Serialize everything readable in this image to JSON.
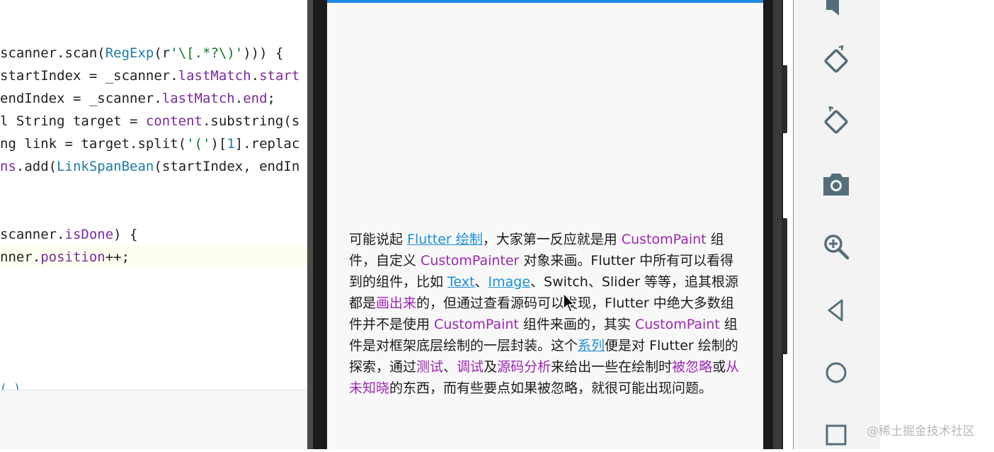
{
  "editor": {
    "lines": [
      [
        {
          "t": "scanner.scan(",
          "c": "c-plain"
        },
        {
          "t": "RegExp",
          "c": "c-cls"
        },
        {
          "t": "(r",
          "c": "c-plain"
        },
        {
          "t": "'\\[.*?\\)'",
          "c": "c-str"
        },
        {
          "t": "))) {",
          "c": "c-plain"
        }
      ],
      [
        {
          "t": "startIndex = _scanner.",
          "c": "c-plain"
        },
        {
          "t": "lastMatch",
          "c": "c-fld"
        },
        {
          "t": ".",
          "c": "c-plain"
        },
        {
          "t": "start",
          "c": "c-fld"
        }
      ],
      [
        {
          "t": "endIndex = _scanner.",
          "c": "c-plain"
        },
        {
          "t": "lastMatch",
          "c": "c-fld"
        },
        {
          "t": ".",
          "c": "c-plain"
        },
        {
          "t": "end",
          "c": "c-fld"
        },
        {
          "t": ";",
          "c": "c-plain"
        }
      ],
      [
        {
          "t": "l String target = ",
          "c": "c-plain"
        },
        {
          "t": "content",
          "c": "c-fld"
        },
        {
          "t": ".substring(s",
          "c": "c-plain"
        }
      ],
      [
        {
          "t": "ng link = target.split(",
          "c": "c-plain"
        },
        {
          "t": "'('",
          "c": "c-str"
        },
        {
          "t": ")[",
          "c": "c-plain"
        },
        {
          "t": "1",
          "c": "c-cls"
        },
        {
          "t": "].replac",
          "c": "c-plain"
        }
      ],
      [
        {
          "t": "ns",
          "c": "c-fld"
        },
        {
          "t": ".add(",
          "c": "c-plain"
        },
        {
          "t": "LinkSpanBean",
          "c": "c-cls"
        },
        {
          "t": "(startIndex, endIn",
          "c": "c-plain"
        }
      ],
      [
        {
          "t": "",
          "c": "c-plain"
        }
      ],
      [
        {
          "t": "",
          "c": "c-plain"
        }
      ],
      [
        {
          "t": "scanner.",
          "c": "c-plain"
        },
        {
          "t": "isDone",
          "c": "c-fld"
        },
        {
          "t": ") {",
          "c": "c-plain"
        }
      ],
      [
        {
          "t": "nner.",
          "c": "c-plain"
        },
        {
          "t": "position",
          "c": "c-fld"
        },
        {
          "t": "++;",
          "c": "c-plain"
        }
      ]
    ]
  },
  "article": {
    "segments": [
      {
        "t": "可能说起 ",
        "c": ""
      },
      {
        "t": "Flutter 绘制",
        "c": "link"
      },
      {
        "t": "，大家第一反应就是用 ",
        "c": ""
      },
      {
        "t": "CustomPaint",
        "c": "purple"
      },
      {
        "t": " 组件，自定义 ",
        "c": ""
      },
      {
        "t": "CustomPainter",
        "c": "purple"
      },
      {
        "t": " 对象来画。Flutter 中所有可以看得到的组件，比如 ",
        "c": ""
      },
      {
        "t": "Text",
        "c": "link"
      },
      {
        "t": "、",
        "c": ""
      },
      {
        "t": "Image",
        "c": "link"
      },
      {
        "t": "、Switch、Slider 等等，追其根源都是",
        "c": ""
      },
      {
        "t": "画出来",
        "c": "purple"
      },
      {
        "t": "的，但通过查看源码可以发现，Flutter 中绝大多数组件并不是使用 ",
        "c": ""
      },
      {
        "t": "CustomPaint",
        "c": "purple"
      },
      {
        "t": " 组件来画的，其实 ",
        "c": ""
      },
      {
        "t": "CustomPaint",
        "c": "purple"
      },
      {
        "t": " 组件是对框架底层绘制的一层封装。这个",
        "c": ""
      },
      {
        "t": "系列",
        "c": "link"
      },
      {
        "t": "便是对 Flutter 绘制的探索，通过",
        "c": ""
      },
      {
        "t": "测试",
        "c": "purple"
      },
      {
        "t": "、",
        "c": ""
      },
      {
        "t": "调试",
        "c": "purple"
      },
      {
        "t": "及",
        "c": ""
      },
      {
        "t": "源码分析",
        "c": "purple"
      },
      {
        "t": "来给出一些在绘制时",
        "c": ""
      },
      {
        "t": "被忽略",
        "c": "purple"
      },
      {
        "t": "或",
        "c": ""
      },
      {
        "t": "从未知晓",
        "c": "purple"
      },
      {
        "t": "的东西，而有些要点如果被忽略，就很可能出现问题。",
        "c": ""
      }
    ]
  },
  "toolbar": {
    "buttons": [
      {
        "name": "volume-down-icon"
      },
      {
        "name": "rotate-left-icon"
      },
      {
        "name": "rotate-right-icon"
      },
      {
        "name": "camera-icon"
      },
      {
        "name": "zoom-icon"
      },
      {
        "name": "back-icon"
      },
      {
        "name": "home-icon"
      },
      {
        "name": "overview-icon"
      }
    ]
  },
  "watermark": "@稀土掘金技术社区",
  "colors": {
    "link": "#1a8fd8",
    "purple": "#9c27b0",
    "appbar": "#1e88e5"
  }
}
